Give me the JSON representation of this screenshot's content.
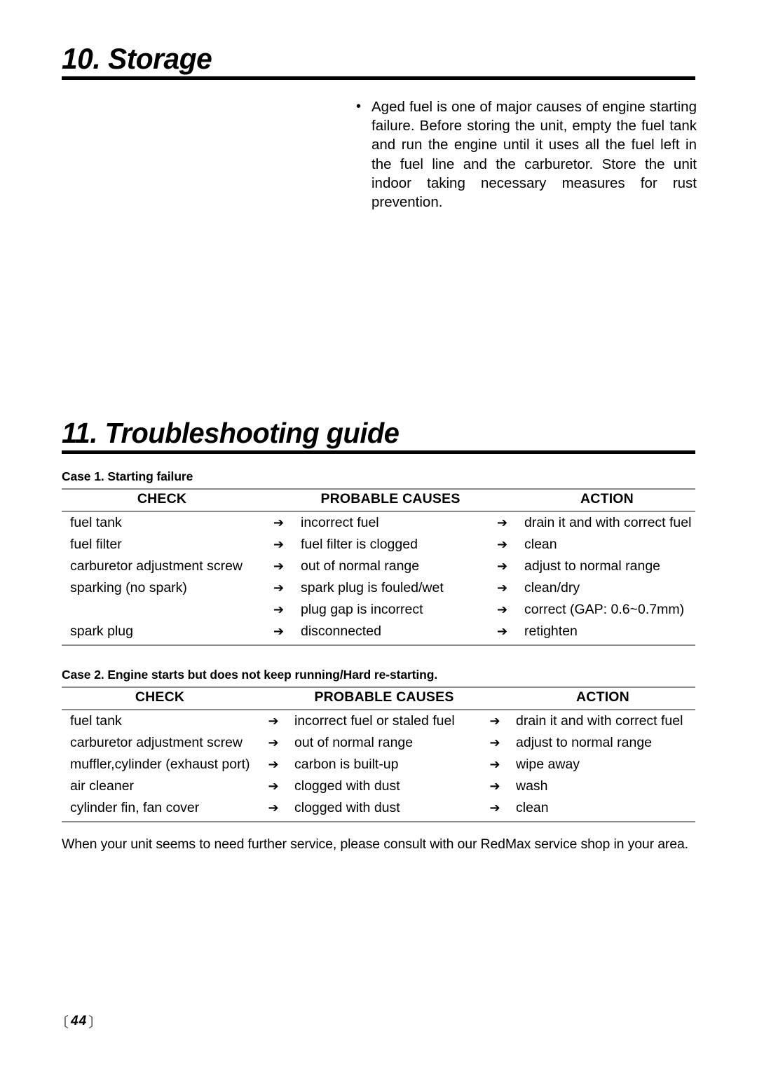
{
  "sections": {
    "storage": {
      "heading": "10. Storage",
      "bullet_mark": "•",
      "bullet_text": "Aged fuel is one of major causes of engine starting failure. Before storing the unit, empty the fuel tank and run the engine until it uses all the fuel left in the fuel line and the carburetor. Store the unit indoor taking necessary measures for rust prevention."
    },
    "troubleshooting": {
      "heading": "11. Troubleshooting guide",
      "columns": [
        "CHECK",
        "PROBABLE CAUSES",
        "ACTION"
      ],
      "arrow": "➔",
      "cases": [
        {
          "label": "Case 1. Starting failure",
          "rows": [
            {
              "check": "fuel tank",
              "cause": "incorrect fuel",
              "action": "drain it and with correct fuel"
            },
            {
              "check": "fuel filter",
              "cause": "fuel filter is clogged",
              "action": "clean"
            },
            {
              "check": "carburetor adjustment screw",
              "cause": "out of normal range",
              "action": "adjust to normal range"
            },
            {
              "check": "sparking (no spark)",
              "cause": "spark plug is fouled/wet",
              "action": "clean/dry"
            },
            {
              "check": "",
              "cause": "plug gap is incorrect",
              "action": "correct (GAP: 0.6~0.7mm)"
            },
            {
              "check": "spark plug",
              "cause": "disconnected",
              "action": "retighten"
            }
          ]
        },
        {
          "label": "Case 2. Engine starts but does not keep running/Hard re-starting.",
          "rows": [
            {
              "check": "fuel tank",
              "cause": "incorrect fuel or staled fuel",
              "action": "drain it and with correct fuel"
            },
            {
              "check": "carburetor adjustment screw",
              "cause": "out of normal range",
              "action": "adjust to normal range"
            },
            {
              "check": "muffler,cylinder (exhaust port)",
              "cause": "carbon is built-up",
              "action": "wipe away"
            },
            {
              "check": "air cleaner",
              "cause": "clogged with dust",
              "action": "wash"
            },
            {
              "check": "cylinder fin, fan cover",
              "cause": "clogged with dust",
              "action": "clean"
            }
          ]
        }
      ],
      "footer_note": "When your unit seems to need further service, please consult with our RedMax service shop in your area."
    }
  },
  "page_number": {
    "left_bracket": "〔",
    "value": "44",
    "right_bracket": "〕"
  }
}
